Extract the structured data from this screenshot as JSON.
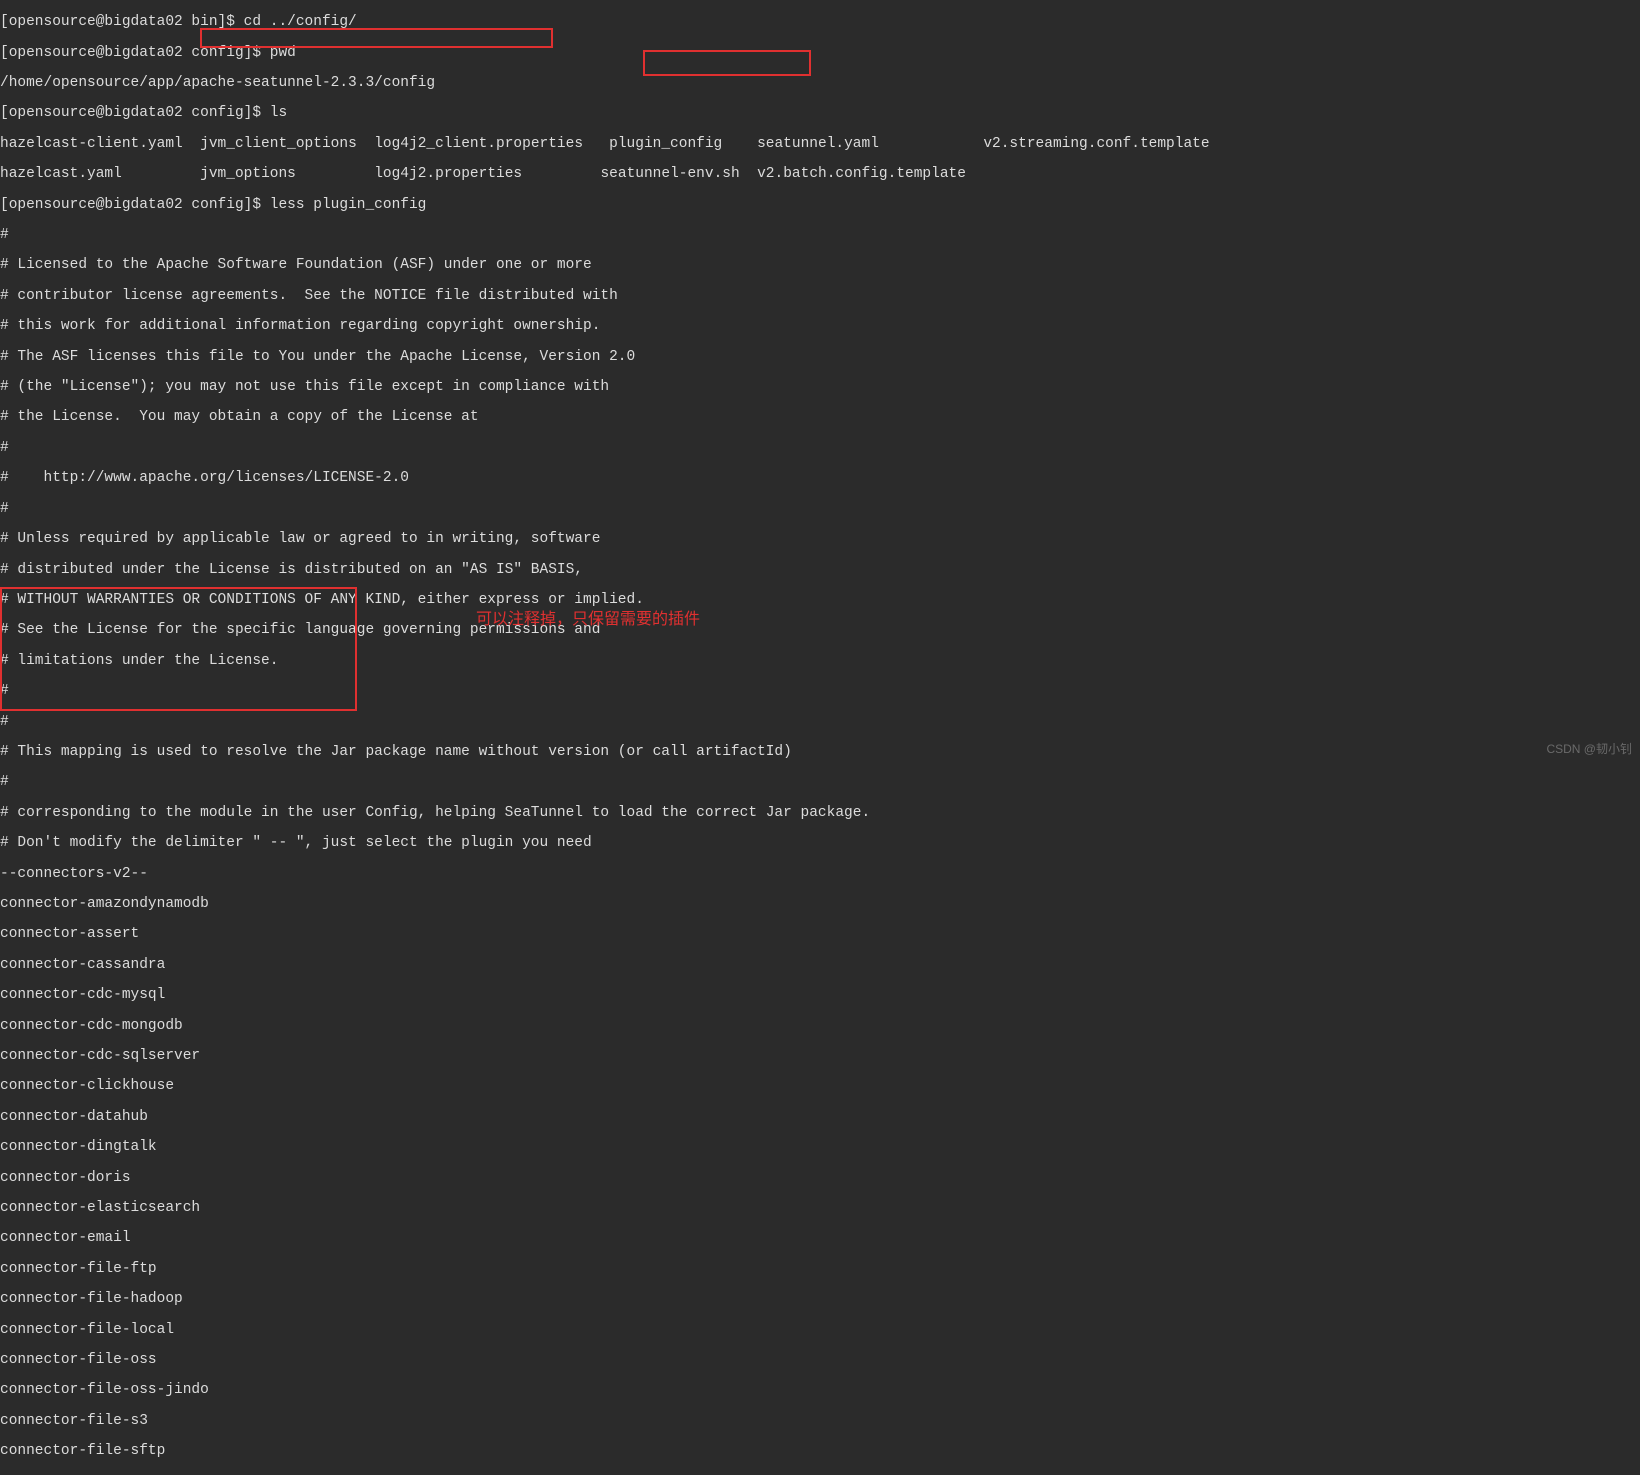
{
  "prompts": {
    "p1": "[opensource@bigdata02 bin]$ ",
    "cmd1": "cd ../config/",
    "p2": "[opensource@bigdata02 config]$ ",
    "cmd2": "pwd",
    "pwd_out_a": "/home/opensource/app/",
    "pwd_out_b": "apache-seatunnel-2.3.3/config",
    "cmd3": "ls",
    "cmd4": "less plugin_config"
  },
  "ls": {
    "c1r1": "hazelcast-client.yaml",
    "c2r1": "jvm_client_options",
    "c3r1": "log4j2_client.properties",
    "c4r1": " plugin_config ",
    "c5r1": "seatunnel.yaml",
    "c6r1": "v2.streaming.conf.template",
    "c1r2": "hazelcast.yaml",
    "c2r2": "jvm_options",
    "c3r2": "log4j2.properties",
    "c4r2": "seatunnel-env.sh",
    "c5r2": "v2.batch.config.template"
  },
  "file": {
    "l1": "#",
    "l2": "# Licensed to the Apache Software Foundation (ASF) under one or more",
    "l3": "# contributor license agreements.  See the NOTICE file distributed with",
    "l4": "# this work for additional information regarding copyright ownership.",
    "l5": "# The ASF licenses this file to You under the Apache License, Version 2.0",
    "l6": "# (the \"License\"); you may not use this file except in compliance with",
    "l7": "# the License.  You may obtain a copy of the License at",
    "l8": "#",
    "l9": "#    http://www.apache.org/licenses/LICENSE-2.0",
    "l10": "#",
    "l11": "# Unless required by applicable law or agreed to in writing, software",
    "l12": "# distributed under the License is distributed on an \"AS IS\" BASIS,",
    "l13": "# WITHOUT WARRANTIES OR CONDITIONS OF ANY KIND, either express or implied.",
    "l14": "# See the License for the specific language governing permissions and",
    "l15": "# limitations under the License.",
    "l16": "#",
    "l17": "#",
    "l18": "# This mapping is used to resolve the Jar package name without version (or call artifactId)",
    "l19": "#",
    "l20": "# corresponding to the module in the user Config, helping SeaTunnel to load the correct Jar package.",
    "l21": "# Don't modify the delimiter \" -- \", just select the plugin you need",
    "l22": "--connectors-v2--",
    "l23": "connector-amazondynamodb",
    "l24": "connector-assert",
    "l25": "connector-cassandra",
    "l26": "connector-cdc-mysql",
    "l27": "connector-cdc-mongodb",
    "l28": "connector-cdc-sqlserver",
    "l29": "connector-clickhouse",
    "l30": "connector-datahub",
    "l31": "connector-dingtalk",
    "l32": "connector-doris",
    "l33": "connector-elasticsearch",
    "l34": "connector-email",
    "l35": "connector-file-ftp",
    "l36": "connector-file-hadoop",
    "l37": "connector-file-local",
    "l38": "connector-file-oss",
    "l39": "connector-file-oss-jindo",
    "l40": "connector-file-s3",
    "l41": "connector-file-sftp"
  },
  "note": "可以注释掉，只保留需要的插件",
  "watermark": "CSDN @韧小钊"
}
